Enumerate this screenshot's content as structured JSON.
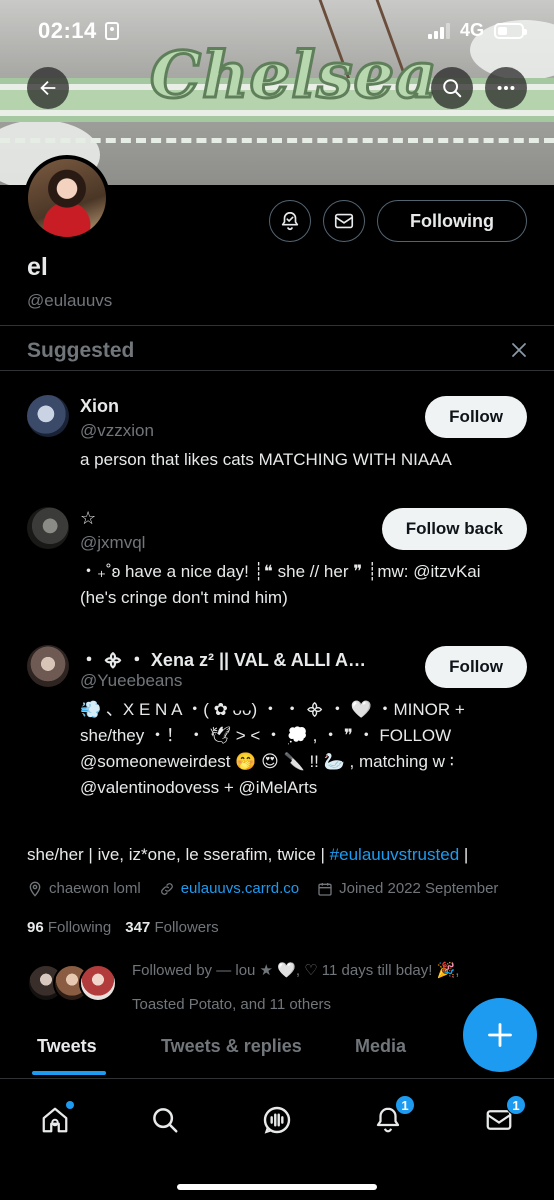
{
  "status_bar": {
    "time": "02:14",
    "network": "4G"
  },
  "banner": {
    "logo_text": "Chelsea",
    "logo_sub": "chelsea"
  },
  "profile": {
    "display_name": "el",
    "handle": "@eulauuvs",
    "following_button": "Following",
    "bio_text": "she/her | ive, iz*one, le sserafim, twice | ",
    "bio_hashtag": "#eulauuvstrusted",
    "bio_tail": " |",
    "location": "chaewon loml",
    "website": "eulauuvs.carrd.co",
    "joined": "Joined 2022 September",
    "following_count": "96",
    "following_label": "Following",
    "followers_count": "347",
    "followers_label": "Followers",
    "followed_by_line1": "Followed by — lou ★ 🤍, ♡ 11 days till bday! 🎉,",
    "followed_by_line2": "Toasted Potato, and 11 others"
  },
  "suggested": {
    "title": "Suggested",
    "items": [
      {
        "name": "Xion",
        "handle": "@vzzxion",
        "button": "Follow",
        "bio": "a person that likes cats MATCHING WITH NIAAA"
      },
      {
        "name": "☆",
        "handle": "@jxmvql",
        "button": "Follow back",
        "bio": "・₊˚ʚ have a nice day! ┊❝ she // her ❞ ┊mw: @itzvKai (he's cringe don't mind him)"
      },
      {
        "name": "・ ᯽ ・ Xena z² || VAL & ALLI AP...",
        "handle": "@Yueebeans",
        "button": "Follow",
        "bio": "💨 、X E N A ・( ✿ ᴗᴗ) ・ ・ ᯽ ・ 🤍 ・MINOR + she/they ・！ ・ 🕊 > < ・ 💭 , ・ ❞ ・ FOLLOW @someoneweirdest 🤭 😍 🔪 !! 🦢 , matching w ∶ @valentinodovess + @iMelArts"
      }
    ]
  },
  "tabs": [
    {
      "label": "Tweets",
      "active": true
    },
    {
      "label": "Tweets & replies",
      "active": false
    },
    {
      "label": "Media",
      "active": false
    }
  ],
  "bottom_nav": {
    "items": [
      "home-icon",
      "search-icon",
      "spaces-icon",
      "notifications-icon",
      "messages-icon"
    ],
    "notifications_badge": "1",
    "messages_badge": "1"
  },
  "colors": {
    "accent": "#1d9bf0",
    "background": "#000000",
    "muted": "#71767b"
  }
}
